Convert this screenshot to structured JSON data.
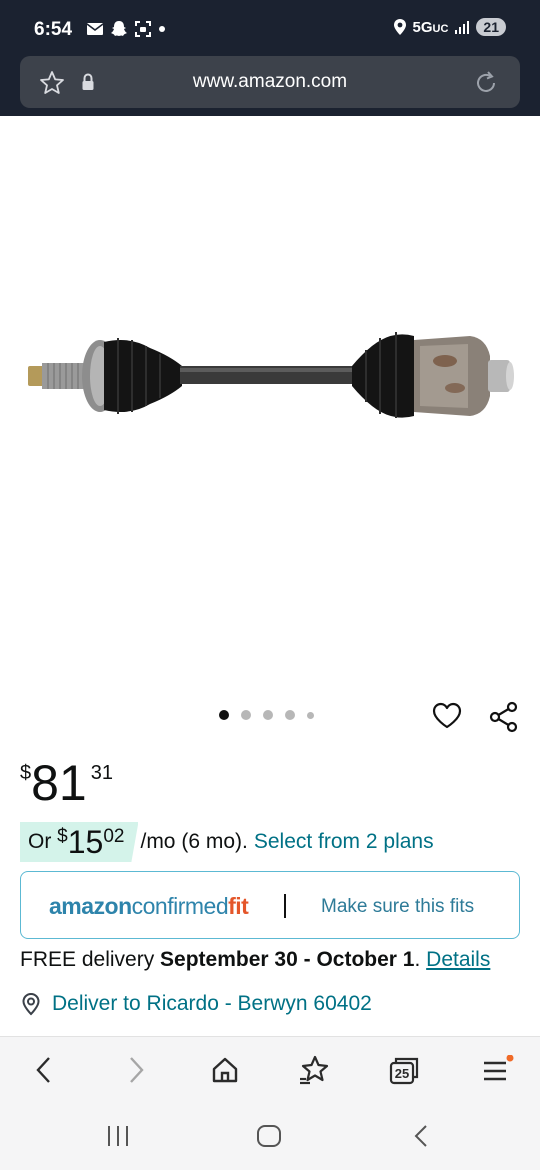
{
  "status_bar": {
    "time": "6:54",
    "network": "5G",
    "network_suffix": "UC",
    "battery": "21"
  },
  "browser": {
    "url": "www.amazon.com"
  },
  "product": {
    "image_icon": "cv-axle-shaft-image",
    "carousel_count": 5,
    "active_index": 0
  },
  "price": {
    "symbol": "$",
    "whole": "81",
    "fraction": "31"
  },
  "monthly": {
    "prefix": "Or ",
    "symbol": "$",
    "whole": "15",
    "fraction": "02",
    "suffix": "/mo (6 mo).",
    "link": "Select from 2 plans"
  },
  "confirmed_fit": {
    "logo_part1": "amazon",
    "logo_part2": "confirmed",
    "logo_part3": "fit",
    "link": "Make sure this fits"
  },
  "delivery": {
    "prefix": "FREE delivery ",
    "dates": "September 30 - October 1",
    "dot": ".",
    "details": "Details"
  },
  "deliver_to": {
    "text": "Deliver to Ricardo - Berwyn 60402"
  },
  "bottom_nav": {
    "tabs_count": "25"
  },
  "colors": {
    "link": "#007185",
    "monthly_bg": "#d4f3ea",
    "fit_border": "#5cb9d3",
    "fit_accent": "#e4562a",
    "status_bg": "#1b2230"
  }
}
